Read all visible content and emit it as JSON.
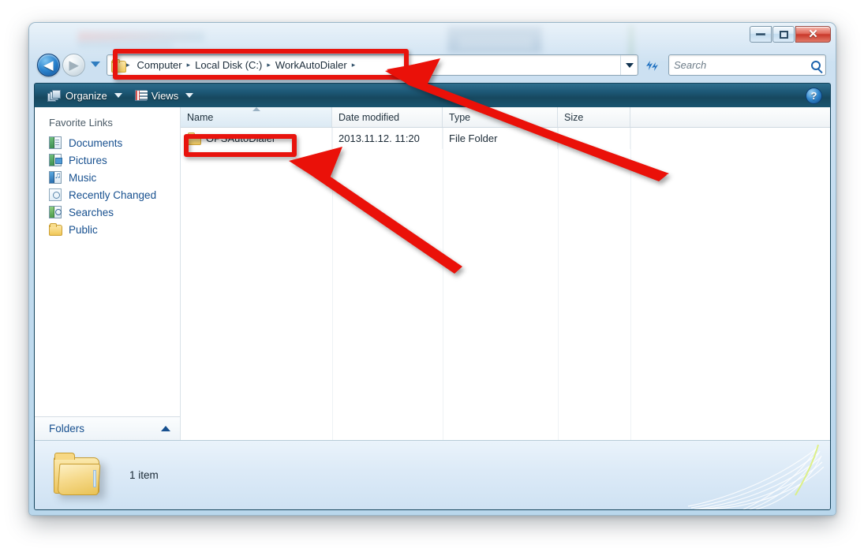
{
  "window": {
    "controls": {
      "minimize": "–",
      "maximize": "□",
      "close": "✕"
    }
  },
  "navigation": {
    "back_label": "◀",
    "forward_label": "▶",
    "history_dropdown": "▾",
    "address": {
      "crumbs": [
        "Computer",
        "Local Disk (C:)",
        "WorkAutoDialer"
      ],
      "separator": "▸",
      "dropdown": "▾"
    },
    "refresh_label": "↻",
    "search": {
      "placeholder": "Search"
    }
  },
  "toolbar": {
    "organize_label": "Organize",
    "views_label": "Views",
    "help_label": "?"
  },
  "sidebar": {
    "title": "Favorite Links",
    "items": [
      {
        "label": "Documents"
      },
      {
        "label": "Pictures"
      },
      {
        "label": "Music"
      },
      {
        "label": "Recently Changed"
      },
      {
        "label": "Searches"
      },
      {
        "label": "Public"
      }
    ],
    "folders_label": "Folders",
    "folders_chevron": "⌃"
  },
  "filelist": {
    "columns": [
      {
        "label": "Name"
      },
      {
        "label": "Date modified"
      },
      {
        "label": "Type"
      },
      {
        "label": "Size"
      }
    ],
    "sort_column": "Name",
    "sort_direction": "ascending",
    "rows": [
      {
        "name": "OPSAutoDialer",
        "date_modified": "2013.11.12. 11:20",
        "type": "File Folder",
        "size": ""
      }
    ]
  },
  "details": {
    "item_count": "1 item"
  },
  "annotations": {
    "highlight_color": "#e8130d",
    "boxes": [
      {
        "target": "address-bar-breadcrumbs"
      },
      {
        "target": "opsautodialer-folder-row"
      }
    ],
    "arrows": [
      {
        "target": "address-bar-breadcrumbs",
        "direction": "up-left"
      },
      {
        "target": "opsautodialer-folder-row",
        "direction": "up-left"
      }
    ]
  }
}
